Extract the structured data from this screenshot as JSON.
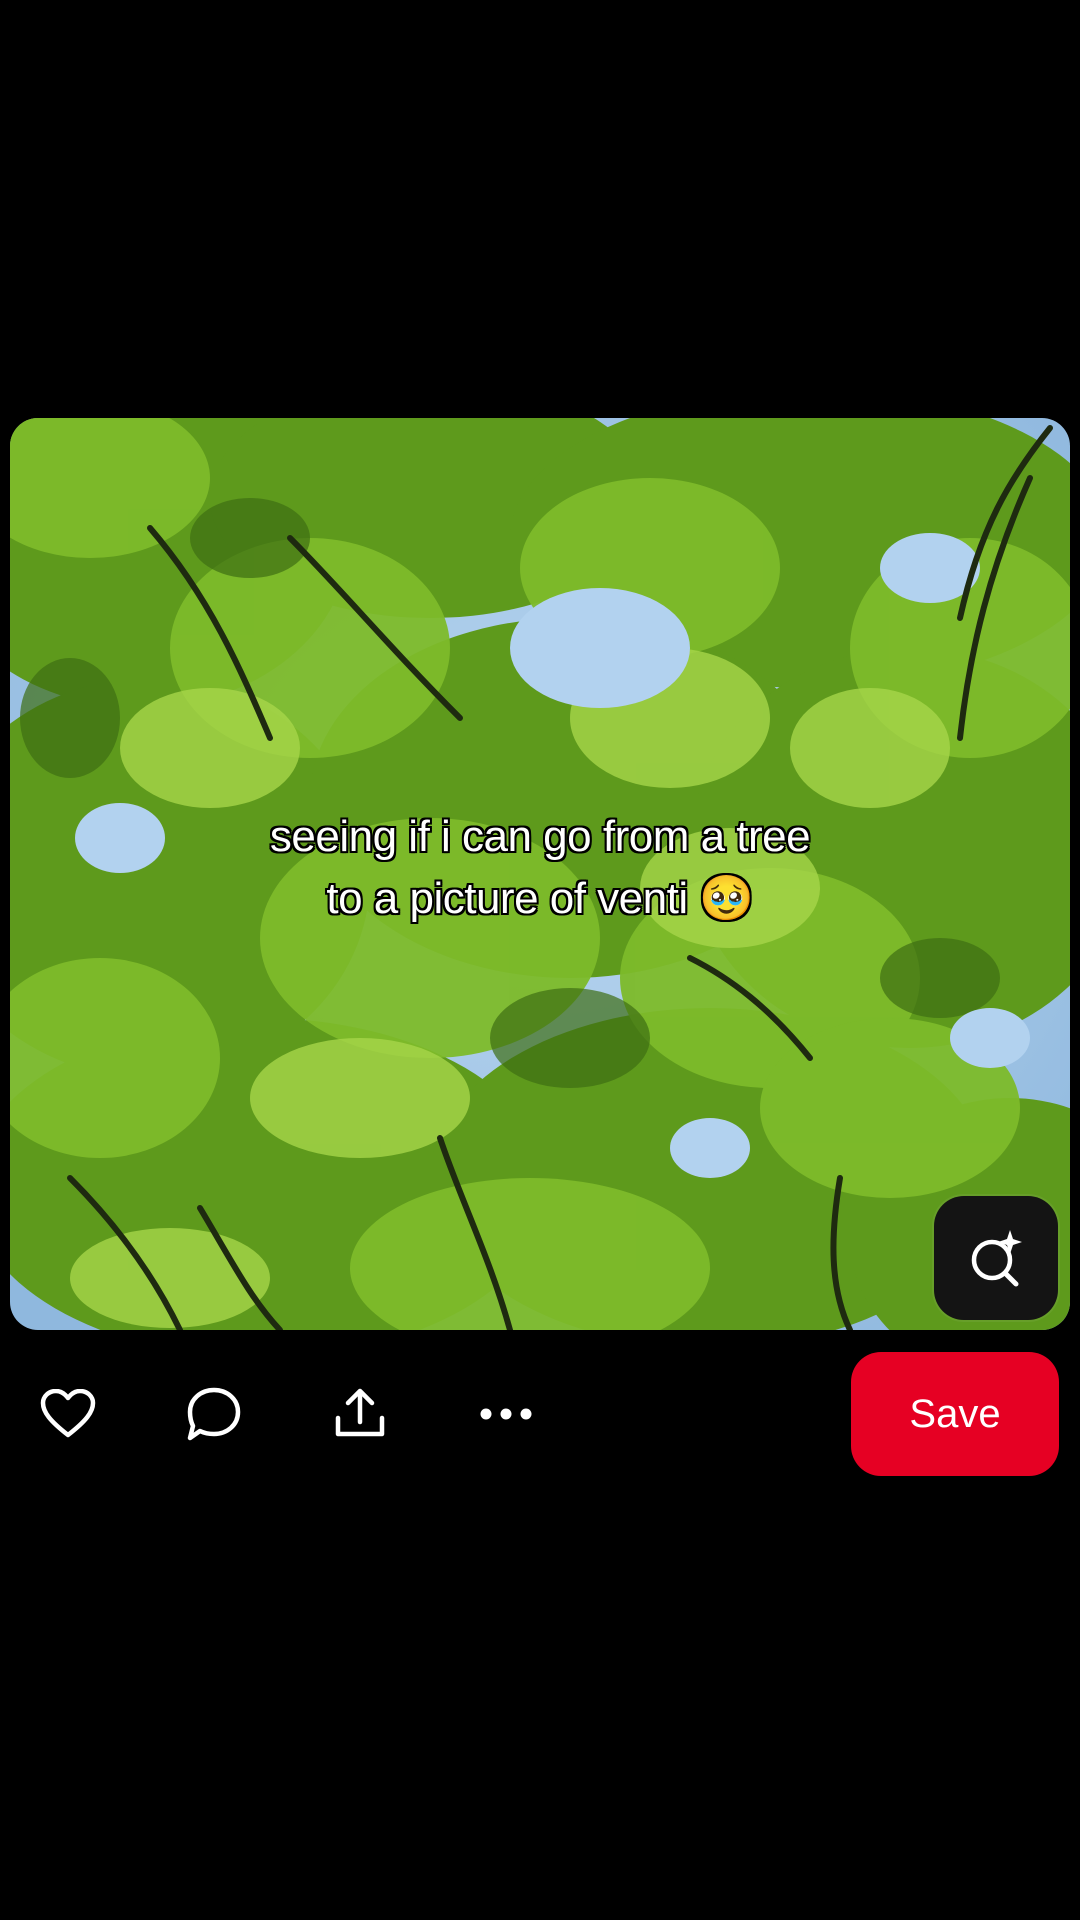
{
  "pin": {
    "caption_line1": "seeing if i can go from a tree",
    "caption_line2": "to a picture of venti 🥹"
  },
  "icons": {
    "visual_search": "sparkle-search-icon",
    "like": "heart-icon",
    "comment": "comment-bubble-icon",
    "share": "share-upload-icon",
    "more": "more-dots-icon"
  },
  "actions": {
    "save_label": "Save"
  },
  "colors": {
    "background": "#000000",
    "save_button": "#e60023",
    "icon": "#ffffff"
  }
}
